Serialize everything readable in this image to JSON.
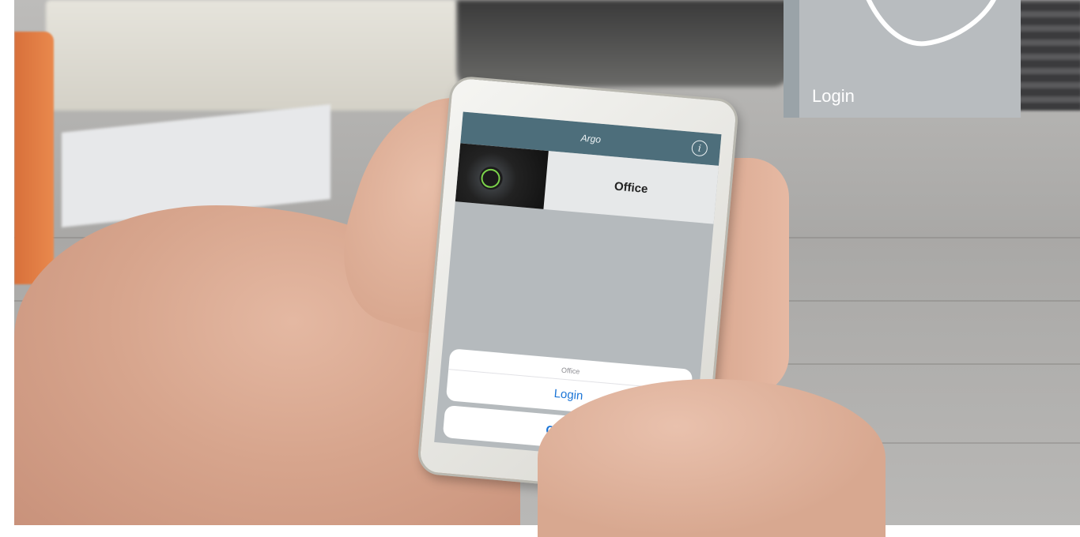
{
  "phone_app": {
    "title": "Argo",
    "lock_name": "Office",
    "action_sheet": {
      "title": "Office",
      "login_label": "Login",
      "cancel_label": "Cancel"
    }
  },
  "overlay": {
    "label": "Login"
  },
  "colors": {
    "app_bar": "#4d6e7b",
    "action_blue": "#1a74d6",
    "overlay_panel": "#b8bcbf"
  },
  "icons": [
    "info-icon",
    "lock-cylinder-image",
    "login-shape-icon"
  ]
}
